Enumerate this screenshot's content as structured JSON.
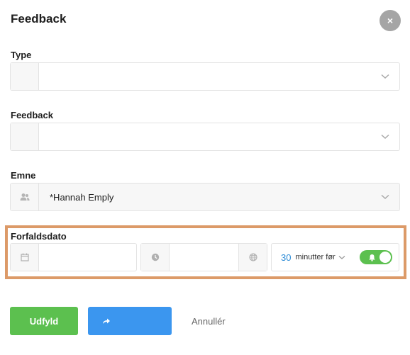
{
  "dialog": {
    "title": "Feedback",
    "close_label": "×"
  },
  "fields": {
    "type": {
      "label": "Type",
      "value": ""
    },
    "feedback": {
      "label": "Feedback",
      "value": ""
    },
    "subject": {
      "label": "Emne",
      "value": "*Hannah Emply"
    },
    "due_date": {
      "label": "Forfaldsdato",
      "date_value": "",
      "time_value": "",
      "reminder_amount": "30",
      "reminder_unit": "minutter før",
      "reminder_enabled": true
    }
  },
  "actions": {
    "fill_label": "Udfyld",
    "cancel_label": "Annullér"
  },
  "colors": {
    "primary_green": "#5cc04f",
    "primary_blue": "#3b96ef",
    "highlight": "#dc9a68",
    "link_blue": "#2a8ad6"
  },
  "icons": [
    "close-icon",
    "chevron-down-icon",
    "users-icon",
    "calendar-icon",
    "clock-icon",
    "globe-icon",
    "bell-icon",
    "share-arrow-icon"
  ]
}
